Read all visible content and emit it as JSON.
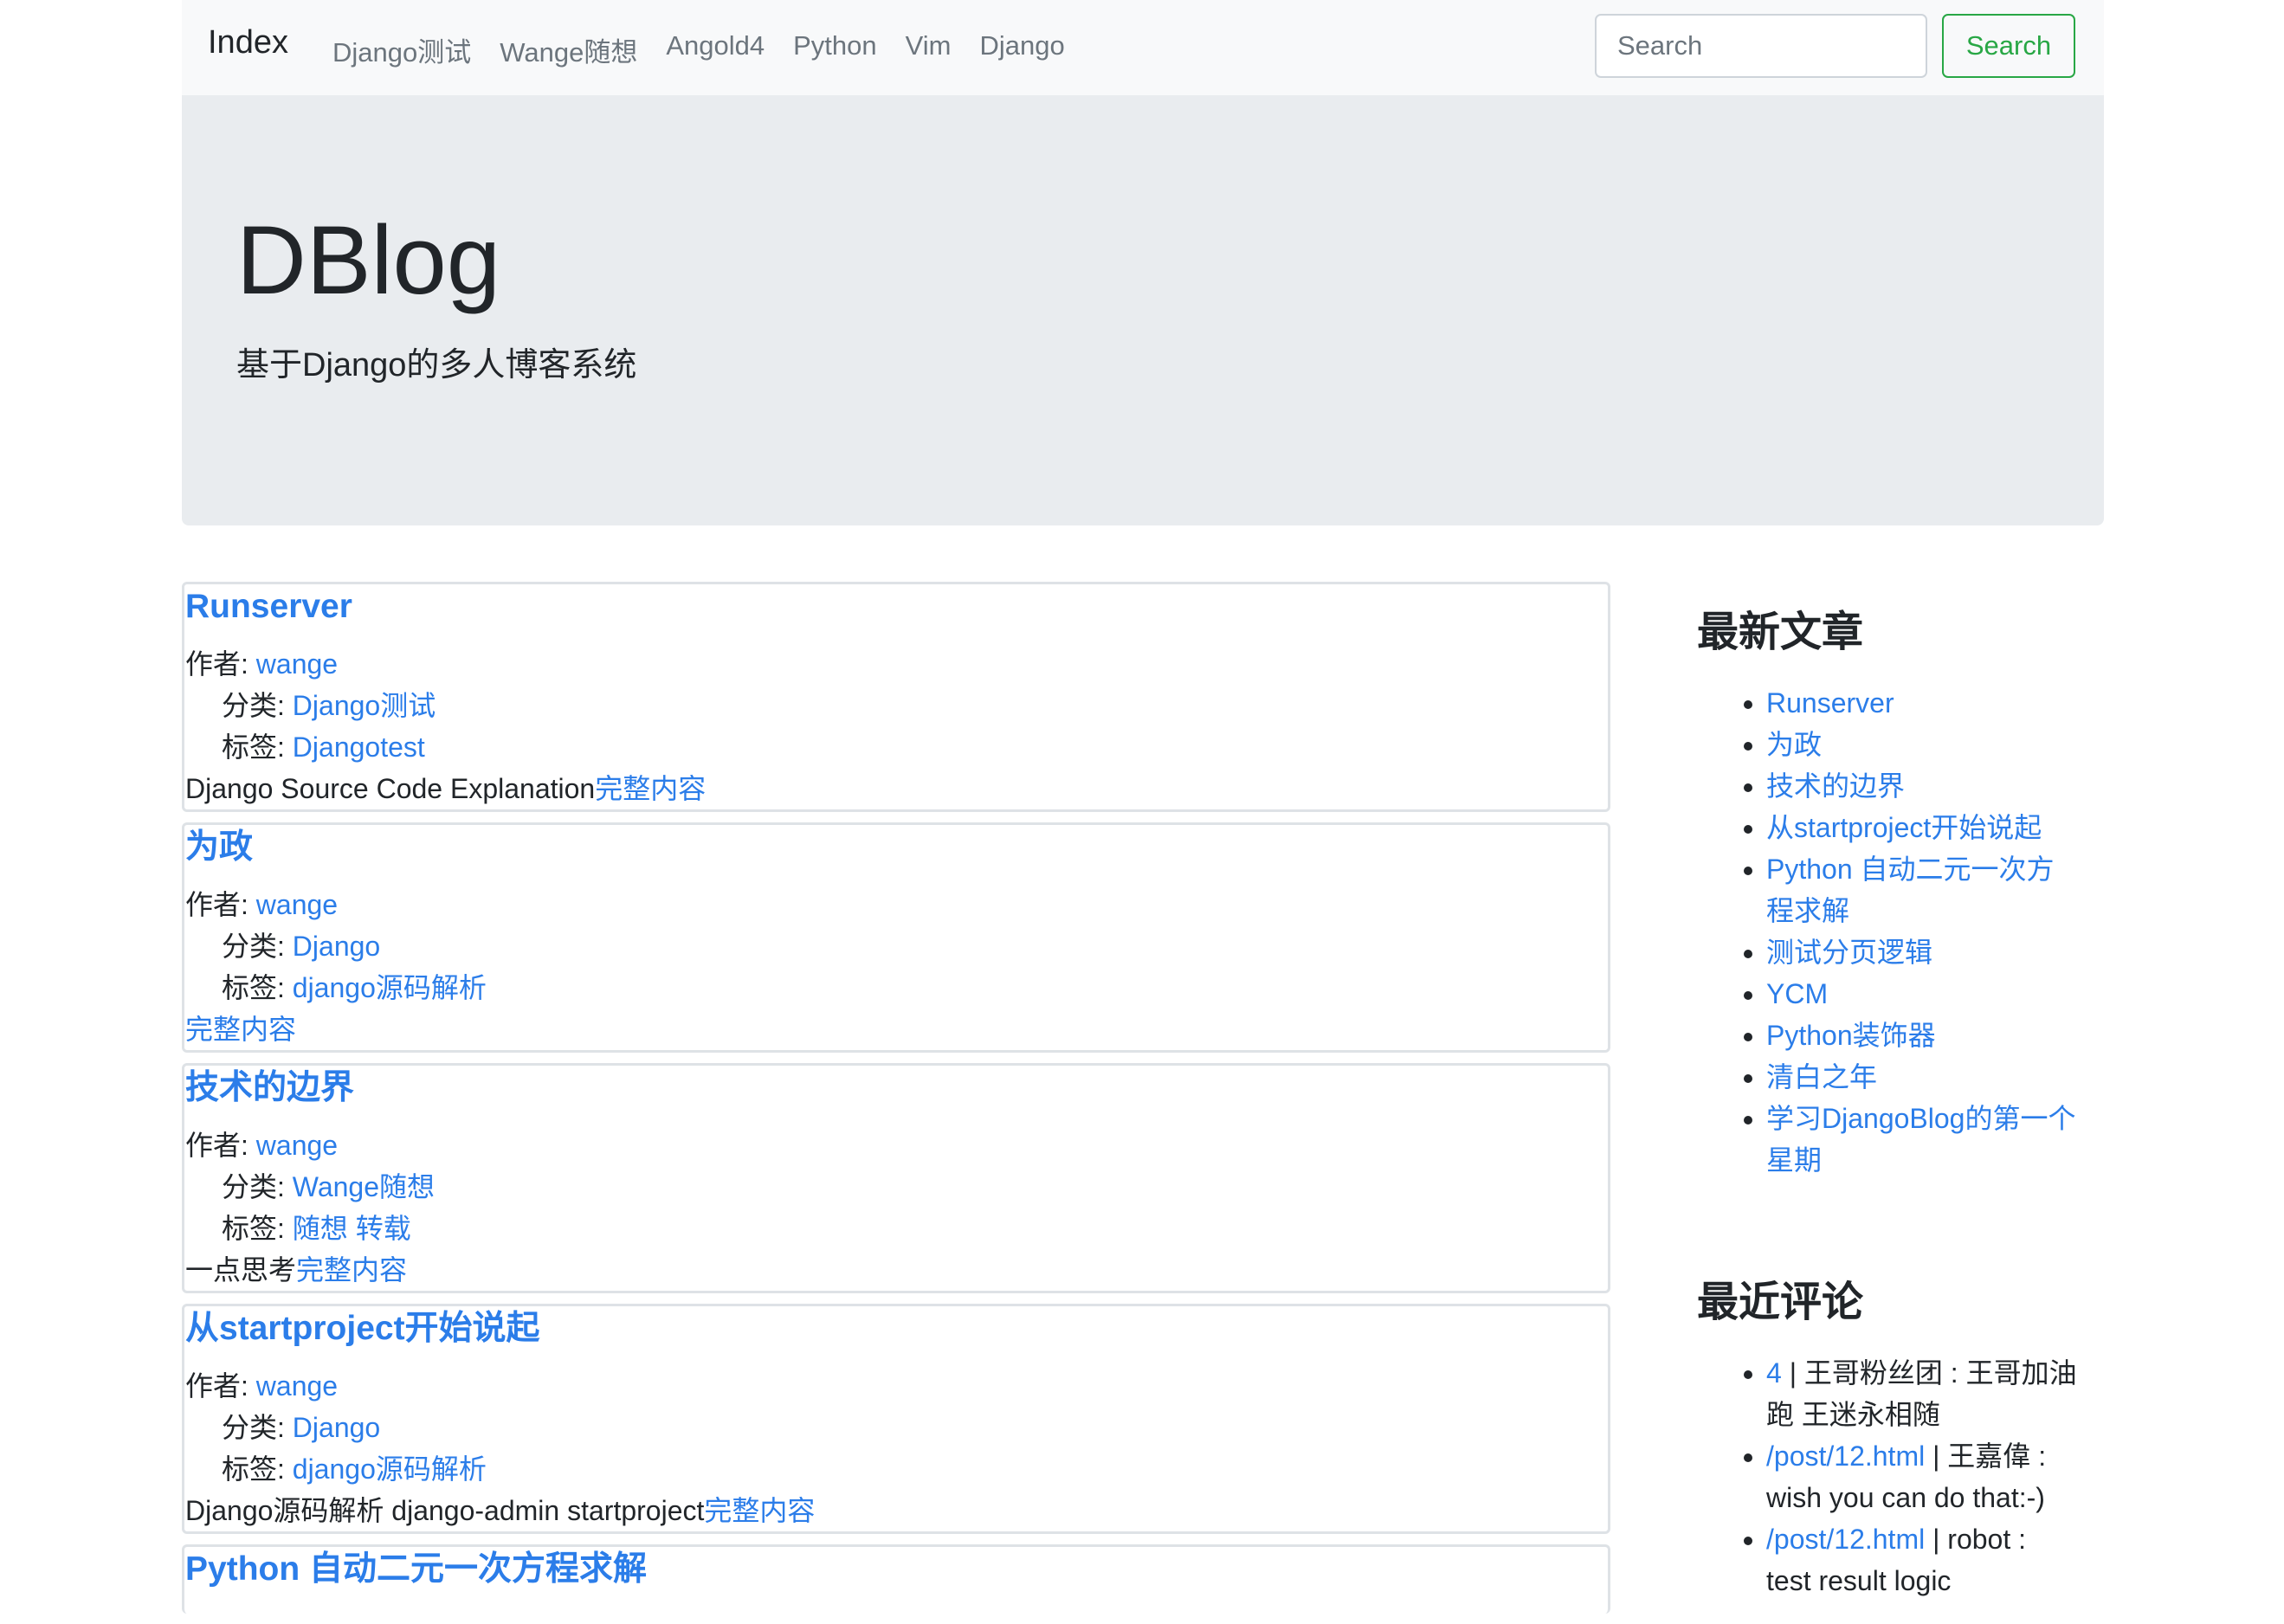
{
  "navbar": {
    "brand": "Index",
    "links": [
      "Django测试",
      "Wange随想",
      "Angold4",
      "Python",
      "Vim",
      "Django"
    ],
    "search_placeholder": "Search",
    "search_button": "Search"
  },
  "jumbotron": {
    "title": "DBlog",
    "subtitle": "基于Django的多人博客系统"
  },
  "labels": {
    "author": "作者: ",
    "category": "分类: ",
    "tags": "标签: ",
    "read_more": "完整内容"
  },
  "posts": [
    {
      "title": "Runserver",
      "author": "wange",
      "category": "Django测试",
      "tags": [
        "Djangotest"
      ],
      "summary": "Django Source Code Explanation"
    },
    {
      "title": "为政",
      "author": "wange",
      "category": "Django",
      "tags": [
        "django源码解析"
      ],
      "summary": ""
    },
    {
      "title": "技术的边界",
      "author": "wange",
      "category": "Wange随想",
      "tags": [
        "随想",
        "转载"
      ],
      "summary": "一点思考"
    },
    {
      "title": "从startproject开始说起",
      "author": "wange",
      "category": "Django",
      "tags": [
        "django源码解析"
      ],
      "summary": "Django源码解析 django-admin startproject"
    },
    {
      "title": "Python 自动二元一次方程求解"
    }
  ],
  "sidebar": {
    "latest_title": "最新文章",
    "latest": [
      "Runserver",
      "为政",
      "技术的边界",
      "从startproject开始说起",
      "Python 自动二元一次方程求解",
      "测试分页逻辑",
      "YCM",
      "Python装饰器",
      "清白之年",
      "学习DjangoBlog的第一个星期"
    ],
    "comments_title": "最近评论",
    "comments": [
      {
        "link": "4",
        "text": " | 王哥粉丝团 : 王哥加油跑 王迷永相随"
      },
      {
        "link": "/post/12.html",
        "text": " | 王嘉偉 : wish you can do that:-)"
      },
      {
        "link": "/post/12.html",
        "text": " | robot : test result logic"
      }
    ]
  }
}
